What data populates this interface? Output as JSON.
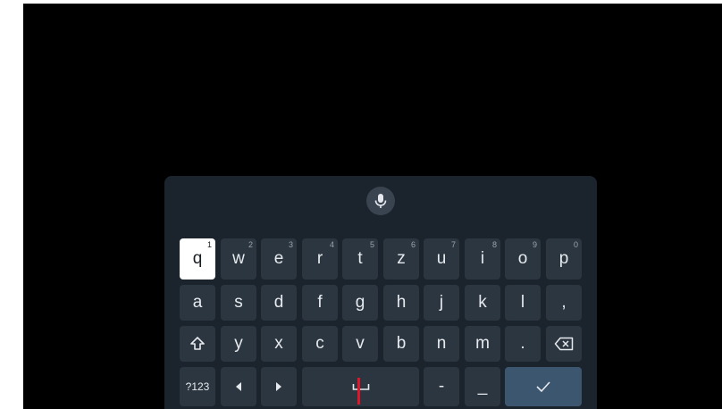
{
  "keyboard": {
    "voice_icon": "microphone-icon",
    "row1": [
      {
        "label": "q",
        "hint": "1"
      },
      {
        "label": "w",
        "hint": "2"
      },
      {
        "label": "e",
        "hint": "3"
      },
      {
        "label": "r",
        "hint": "4"
      },
      {
        "label": "t",
        "hint": "5"
      },
      {
        "label": "z",
        "hint": "6"
      },
      {
        "label": "u",
        "hint": "7"
      },
      {
        "label": "i",
        "hint": "8"
      },
      {
        "label": "o",
        "hint": "9"
      },
      {
        "label": "p",
        "hint": "0"
      }
    ],
    "row2": [
      "a",
      "s",
      "d",
      "f",
      "g",
      "h",
      "j",
      "k",
      "l",
      ","
    ],
    "row3": [
      "y",
      "x",
      "c",
      "v",
      "b",
      "n",
      "m",
      "."
    ],
    "symbols_label": "?123",
    "dash_label": "-",
    "underscore_label": "_",
    "icons": {
      "shift": "shift-icon",
      "backspace": "backspace-icon",
      "left": "arrow-left-icon",
      "right": "arrow-right-icon",
      "space": "space-icon",
      "enter": "checkmark-icon"
    },
    "focused_key": "q",
    "colors": {
      "keyboard_bg": "#1b232c",
      "key_bg": "#2c3640",
      "focus_bg": "#ffffff",
      "enter_bg": "#3d5670",
      "cursor": "#e0162b"
    }
  }
}
